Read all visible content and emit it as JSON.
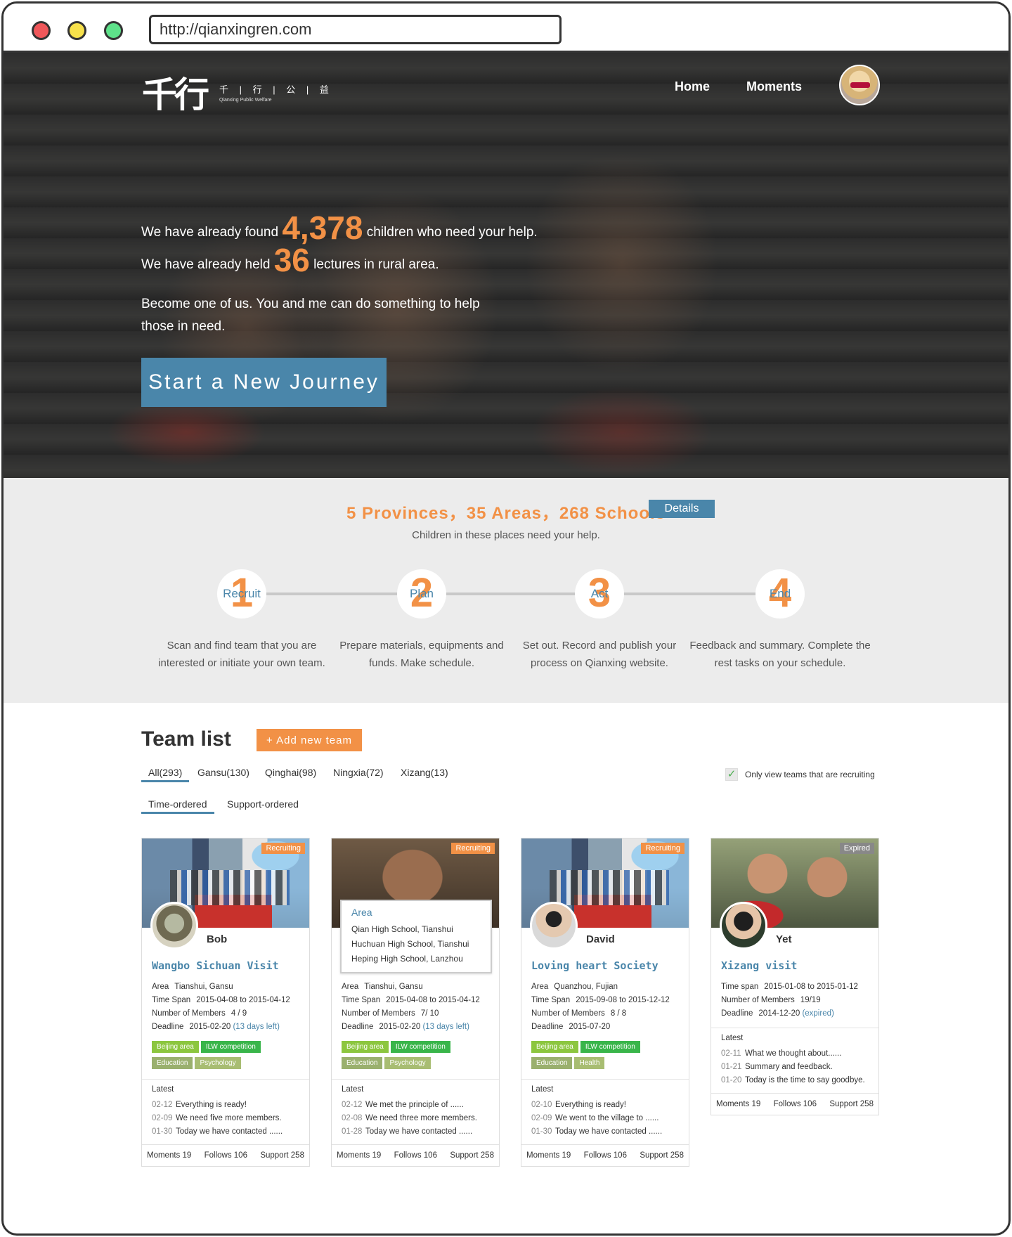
{
  "browser": {
    "url": "http://qianxingren.com"
  },
  "header": {
    "logo_mark": "千行",
    "logo_cn": "千 | 行 | 公 | 益",
    "logo_en": "Qianxing Public Welfare",
    "nav": [
      {
        "label": "Home"
      },
      {
        "label": "Moments"
      }
    ]
  },
  "hero": {
    "line1_pre": "We have already found",
    "children_count": "4,378",
    "line1_post": "children who need your help.",
    "line2_pre": "We have already held",
    "lecture_count": "36",
    "line2_post": "lectures in rural area.",
    "line3": "Become one of us. You and me can do something to help those in need.",
    "cta_label": "Start a New Journey"
  },
  "stats": {
    "title": "5 Provinces，35 Areas，268 Schools",
    "details_label": "Details",
    "subtitle": "Children in these places need your help.",
    "steps": [
      {
        "num": "1",
        "label": "Recruit",
        "desc": "Scan and find team that you are interested or initiate your own team."
      },
      {
        "num": "2",
        "label": "Plan",
        "desc": "Prepare materials, equipments and funds. Make schedule."
      },
      {
        "num": "3",
        "label": "Act",
        "desc": "Set out. Record and publish your process on Qianxing website."
      },
      {
        "num": "4",
        "label": "End",
        "desc": "Feedback and summary. Complete the rest tasks on your schedule."
      }
    ]
  },
  "teams": {
    "title": "Team list",
    "add_label": "+ Add new team",
    "filters": [
      {
        "label": "All(293)"
      },
      {
        "label": "Gansu(130)"
      },
      {
        "label": "Qinghai(98)"
      },
      {
        "label": "Ningxia(72)"
      },
      {
        "label": "Xizang(13)"
      }
    ],
    "sorts": [
      {
        "label": "Time-ordered"
      },
      {
        "label": "Support-ordered"
      }
    ],
    "recruit_only_label": "Only view teams that are recruiting",
    "area_popup": {
      "heading": "Area",
      "rows": [
        "Qian High School, Tianshui",
        "Huchuan High School, Tianshui",
        "Heping High School, Lanzhou"
      ]
    },
    "cards": [
      {
        "badge": "Recruiting",
        "name": "Bob",
        "title": "Wangbo Sichuan Visit",
        "rows": [
          {
            "k": "Area",
            "v": "Tianshui, Gansu"
          },
          {
            "k": "Time Span",
            "v": "2015-04-08 to 2015-04-12"
          },
          {
            "k": "Number of Members",
            "v": "4 / 9"
          },
          {
            "k": "Deadline",
            "v": "2015-02-20",
            "note": "(13 days left)"
          }
        ],
        "tags": [
          "Beijing area",
          "ILW competition",
          "Education",
          "Psychology"
        ],
        "latest_label": "Latest",
        "latest": [
          {
            "d": "02-12",
            "t": "Everything is ready!"
          },
          {
            "d": "02-09",
            "t": "We need five more members."
          },
          {
            "d": "01-30",
            "t": "Today we have contacted ......"
          }
        ],
        "moments": "Moments  19",
        "follows": "Follows 106",
        "support": "Support 258"
      },
      {
        "badge": "Recruiting",
        "name": "",
        "title": "",
        "rows": [
          {
            "k": "Area",
            "v": "Tianshui, Gansu"
          },
          {
            "k": "Time Span",
            "v": "2015-04-08 to 2015-04-12"
          },
          {
            "k": "Number of Members",
            "v": "7/ 10"
          },
          {
            "k": "Deadline",
            "v": "2015-02-20",
            "note": "(13 days left)"
          }
        ],
        "tags": [
          "Beijing area",
          "ILW competition",
          "Education",
          "Psychology"
        ],
        "latest_label": "Latest",
        "latest": [
          {
            "d": "02-12",
            "t": "We met the principle of ......"
          },
          {
            "d": "02-08",
            "t": "We need three more members."
          },
          {
            "d": "01-28",
            "t": "Today we have contacted ......"
          }
        ],
        "moments": "Moments  19",
        "follows": "Follows 106",
        "support": "Support 258"
      },
      {
        "badge": "Recruiting",
        "name": "David",
        "title": "Loving heart Society",
        "rows": [
          {
            "k": "Area",
            "v": "Quanzhou, Fujian"
          },
          {
            "k": "Time Span",
            "v": "2015-09-08 to 2015-12-12"
          },
          {
            "k": "Number of Members",
            "v": "8 / 8"
          },
          {
            "k": "Deadline",
            "v": "2015-07-20",
            "note": ""
          }
        ],
        "tags": [
          "Beijing area",
          "ILW competition",
          "Education",
          "Health"
        ],
        "latest_label": "Latest",
        "latest": [
          {
            "d": "02-10",
            "t": "Everything is ready!"
          },
          {
            "d": "02-09",
            "t": "We went to the village to ......"
          },
          {
            "d": "01-30",
            "t": "Today we have contacted ......"
          }
        ],
        "moments": "Moments  19",
        "follows": "Follows 106",
        "support": "Support 258"
      },
      {
        "badge": "Expired",
        "name": "Yet",
        "title": "Xizang visit",
        "rows": [
          {
            "k": "Time span",
            "v": "2015-01-08 to 2015-01-12"
          },
          {
            "k": "Number of Members",
            "v": "19/19"
          },
          {
            "k": "Deadline",
            "v": "2014-12-20",
            "note": "(expired)"
          }
        ],
        "tags": [],
        "latest_label": "Latest",
        "latest": [
          {
            "d": "02-11",
            "t": "What we thought about......"
          },
          {
            "d": "01-21",
            "t": "Summary and feedback."
          },
          {
            "d": "01-20",
            "t": "Today is the time to say goodbye."
          }
        ],
        "moments": "Moments  19",
        "follows": "Follows 106",
        "support": "Support 258"
      }
    ]
  }
}
